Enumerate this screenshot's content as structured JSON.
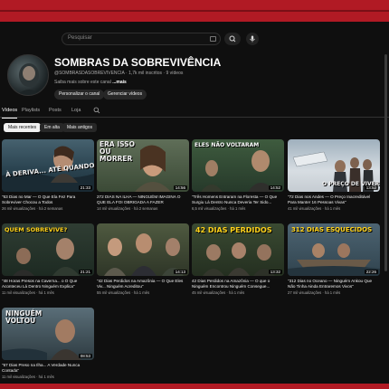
{
  "topbar": {
    "search_placeholder": "Pesquisar"
  },
  "channel": {
    "title": "SOMBRAS DA SOBREVIVÊNCIA",
    "handle": "@SOMBRASDASOBREVIVENCIA",
    "subscribers": "1,7k mil inscritos",
    "video_count": "9 vídeos",
    "description": "Saiba mais sobre este canal",
    "more": "...mais",
    "customize_label": "Personalizar o canal",
    "manage_label": "Gerenciar vídeos"
  },
  "tabs": [
    {
      "label": "Vídeos",
      "active": true
    },
    {
      "label": "Playlists"
    },
    {
      "label": "Posts"
    },
    {
      "label": "Loja"
    }
  ],
  "chips": [
    "Mais recentes",
    "Em alta",
    "Mais antigos"
  ],
  "videos": [
    {
      "title": "\"63 Dias no Mar — O Que Ela Fez Para Sobreviver Chocou a Todos",
      "views": "26 mil visualizações",
      "age": "há 2 semanas",
      "duration": "21:33",
      "overlay": "À DERIVA... ATÉ QUANDO?",
      "overlay_color": "#ffffff"
    },
    {
      "title": "272 DIAS NA ILHA — NINGUÉM IMAGINA O QUE ELA FOI OBRIGADA A FAZER",
      "views": "14 mil visualizações",
      "age": "há 2 semanas",
      "duration": "14:56",
      "overlay": "ERA ISSO OU MORRER",
      "overlay_color": "#ffd21a"
    },
    {
      "title": "\"Três Homens Entraram na Floresta — O Que Surgiu Lá Dentro Nunca Deveria Ter Sido...",
      "views": "6,5 mil visualizações",
      "age": "há 1 mês",
      "duration": "14:52",
      "overlay": "ELES NÃO VOLTARAM",
      "overlay_color": "#ffffff"
    },
    {
      "title": "\"72 Dias nos Andes — O Preço Inacreditável Para Manter 16 Pessoas Vivas\"",
      "views": "41 mil visualizações",
      "age": "há 1 mês",
      "duration": "13:52",
      "overlay": "O PREÇO DE VIVER",
      "overlay_color": "#ffffff"
    },
    {
      "title": "\"48 Horas Presos na Caverna... o O Que Aconteceu Lá Dentro Ninguém Explica\"",
      "views": "11 mil visualizações",
      "age": "há 1 mês",
      "duration": "21:21",
      "overlay": "QUEM SOBREVIVE?",
      "overlay_color": "#ffd21a"
    },
    {
      "title": "\"42 Dias Perdidos na Amazônia — O Que Eles Viv... Ninguém Acreditou\"",
      "views": "55 mil visualizações",
      "age": "há 1 mês",
      "duration": "14:13",
      "overlay": "",
      "overlay_color": "#ffffff"
    },
    {
      "title": "42 Dias Perdidos na Amazônia — O que o Ninguém Encontrou Ninguém Consegue...",
      "views": "45 mil visualizações",
      "age": "há 1 mês",
      "duration": "13:32",
      "overlay": "42 DIAS PERDIDOS",
      "overlay_color": "#ffd21a"
    },
    {
      "title": "\"312 Dias no Oceano — Ninguém Ankou Que Não Tinha Ainda Entraremos Vivos\"",
      "views": "27 mil visualizações",
      "age": "há 1 mês",
      "duration": "22:26",
      "overlay": "312 DIAS ESQUECIDOS",
      "overlay_color": "#ffd21a"
    },
    {
      "title": "\"67 Dias Preso na Ilha... A Verdade Nunca Contada\"",
      "views": "11 mil visualizações",
      "age": "há 1 mês",
      "duration": "08:53",
      "overlay": "NINGUÉM VOLTOU",
      "overlay_color": "#ffffff"
    }
  ]
}
